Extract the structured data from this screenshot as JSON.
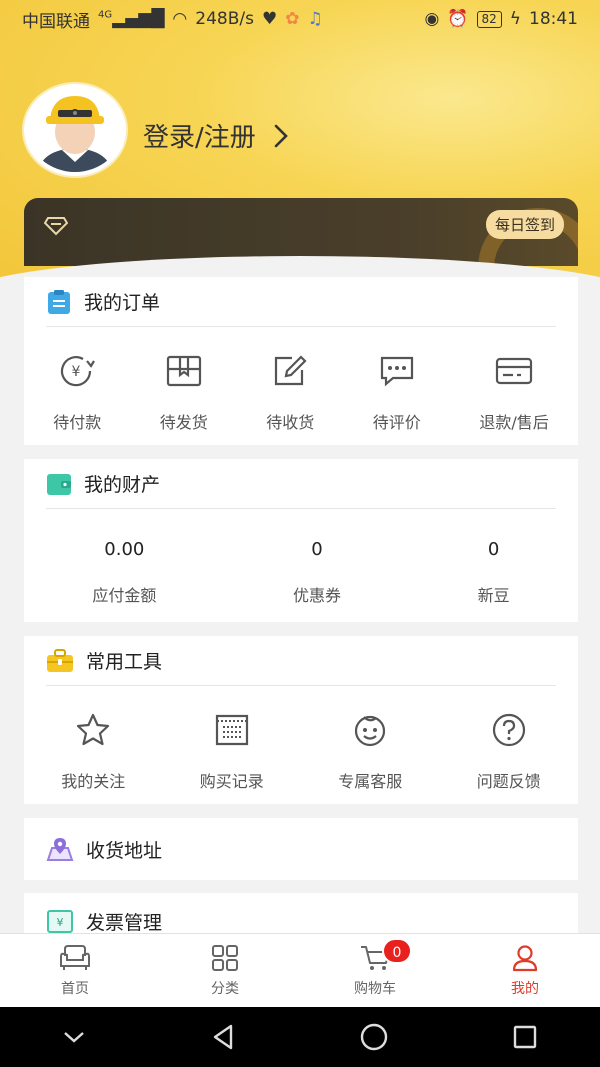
{
  "status_bar": {
    "carrier": "中国联通",
    "network": "4G",
    "speed": "248B/s",
    "battery": "82",
    "time": "18:41"
  },
  "profile": {
    "login_label": "登录/注册"
  },
  "member": {
    "checkin_label": "每日签到"
  },
  "orders": {
    "title": "我的订单",
    "items": [
      {
        "label": "待付款",
        "icon": "yen-refresh-icon"
      },
      {
        "label": "待发货",
        "icon": "box-icon"
      },
      {
        "label": "待收货",
        "icon": "edit-icon"
      },
      {
        "label": "待评价",
        "icon": "chat-icon"
      },
      {
        "label": "退款/售后",
        "icon": "card-icon"
      }
    ]
  },
  "assets": {
    "title": "我的财产",
    "items": [
      {
        "value": "0.00",
        "label": "应付金额"
      },
      {
        "value": "0",
        "label": "优惠券"
      },
      {
        "value": "0",
        "label": "新豆"
      }
    ]
  },
  "tools": {
    "title": "常用工具",
    "items": [
      {
        "label": "我的关注",
        "icon": "star-icon"
      },
      {
        "label": "购买记录",
        "icon": "receipt-icon"
      },
      {
        "label": "专属客服",
        "icon": "service-face-icon"
      },
      {
        "label": "问题反馈",
        "icon": "question-icon"
      }
    ]
  },
  "address": {
    "title": "收货地址"
  },
  "invoice": {
    "title": "发票管理"
  },
  "tabbar": {
    "items": [
      {
        "label": "首页",
        "icon": "sofa-home-icon"
      },
      {
        "label": "分类",
        "icon": "grid-icon"
      },
      {
        "label": "购物车",
        "icon": "cart-icon",
        "badge": "0"
      },
      {
        "label": "我的",
        "icon": "user-icon",
        "active": true
      }
    ]
  },
  "colors": {
    "accent": "#e03a2a",
    "header_yellow": "#f7d554",
    "member_dark": "#3b3426"
  }
}
